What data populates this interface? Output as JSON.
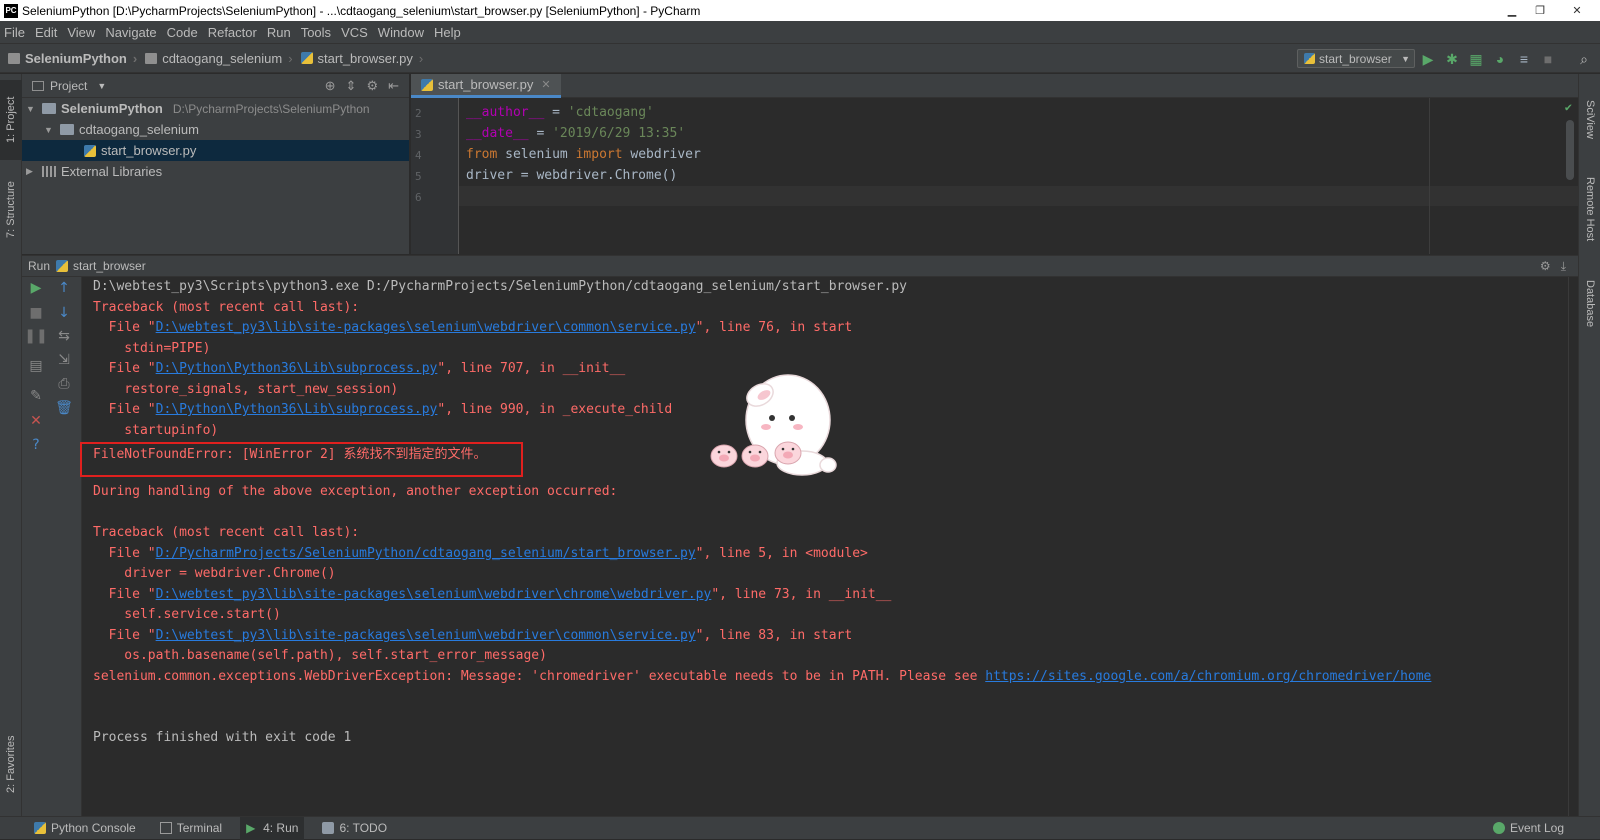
{
  "window": {
    "title": "SeleniumPython [D:\\PycharmProjects\\SeleniumPython] - ...\\cdtaogang_selenium\\start_browser.py [SeleniumPython] - PyCharm",
    "app_icon": "PC",
    "minimize": "▁",
    "maximize": "❐",
    "close": "✕"
  },
  "menu": [
    "File",
    "Edit",
    "View",
    "Navigate",
    "Code",
    "Refactor",
    "Run",
    "Tools",
    "VCS",
    "Window",
    "Help"
  ],
  "breadcrumb": {
    "project": "SeleniumPython",
    "folder": "cdtaogang_selenium",
    "file": "start_browser.py"
  },
  "run_config": {
    "selected": "start_browser"
  },
  "left_tabs": {
    "project": "1: Project",
    "structure": "7: Structure",
    "favorites": "2: Favorites"
  },
  "right_tabs": {
    "sciview": "SciView",
    "remote_host": "Remote Host",
    "database": "Database"
  },
  "project_panel": {
    "title": "Project",
    "tree": [
      {
        "label": "SeleniumPython",
        "path": "D:\\PycharmProjects\\SeleniumPython"
      },
      {
        "label": "cdtaogang_selenium"
      },
      {
        "label": "start_browser.py"
      },
      {
        "label": "External Libraries"
      }
    ]
  },
  "editor": {
    "tab_label": "start_browser.py",
    "line_numbers": [
      "2",
      "3",
      "4",
      "5",
      "6"
    ],
    "lines": [
      {
        "name": "__author__",
        "op": " = ",
        "value": "'cdtaogang'"
      },
      {
        "name": "__date__",
        "op": " = ",
        "value": "'2019/6/29 13:35'"
      },
      {
        "kw1": "from",
        "mod": " selenium ",
        "kw2": "import",
        "rest": " webdriver"
      },
      {
        "text": "driver = webdriver.Chrome()"
      }
    ]
  },
  "run_panel": {
    "label": "Run",
    "config": "start_browser",
    "console": {
      "cmd": "D:\\webtest_py3\\Scripts\\python3.exe D:/PycharmProjects/SeleniumPython/cdtaogang_selenium/start_browser.py",
      "tb1": "Traceback (most recent call last):",
      "f1_pre": "  File \"",
      "f1_link": "D:\\webtest_py3\\lib\\site-packages\\selenium\\webdriver\\common\\service.py",
      "f1_post": "\", line 76, in start",
      "f1_code": "    stdin=PIPE)",
      "f2_pre": "  File \"",
      "f2_link": "D:\\Python\\Python36\\Lib\\subprocess.py",
      "f2_post": "\", line 707, in __init__",
      "f2_code": "    restore_signals, start_new_session)",
      "f3_pre": "  File \"",
      "f3_link": "D:\\Python\\Python36\\Lib\\subprocess.py",
      "f3_post": "\", line 990, in _execute_child",
      "f3_code": "    startupinfo)",
      "fnf": "FileNotFoundError: [WinError 2] 系统找不到指定的文件。",
      "during": "During handling of the above exception, another exception occurred:",
      "tb2": "Traceback (most recent call last):",
      "g1_pre": "  File \"",
      "g1_link": "D:/PycharmProjects/SeleniumPython/cdtaogang_selenium/start_browser.py",
      "g1_post": "\", line 5, in <module>",
      "g1_code": "    driver = webdriver.Chrome()",
      "g2_pre": "  File \"",
      "g2_link": "D:\\webtest_py3\\lib\\site-packages\\selenium\\webdriver\\chrome\\webdriver.py",
      "g2_post": "\", line 73, in __init__",
      "g2_code": "    self.service.start()",
      "g3_pre": "  File \"",
      "g3_link": "D:\\webtest_py3\\lib\\site-packages\\selenium\\webdriver\\common\\service.py",
      "g3_post": "\", line 83, in start",
      "g3_code": "    os.path.basename(self.path), self.start_error_message)",
      "exc_pre": "selenium.common.exceptions.WebDriverException: Message: 'chromedriver' executable needs to be in PATH. Please see ",
      "exc_link": "https://sites.google.com/a/chromium.org/chromedriver/home",
      "exit": "Process finished with exit code 1"
    }
  },
  "statusbar": {
    "python_console": "Python Console",
    "terminal": "Terminal",
    "run": "4: Run",
    "todo": "6: TODO",
    "event_log": "Event Log"
  },
  "colors": {
    "error": "#ff6b68",
    "link": "#287bde",
    "highlight_box": "#e0201e",
    "keyword": "#cc7832",
    "string": "#6a8759"
  }
}
